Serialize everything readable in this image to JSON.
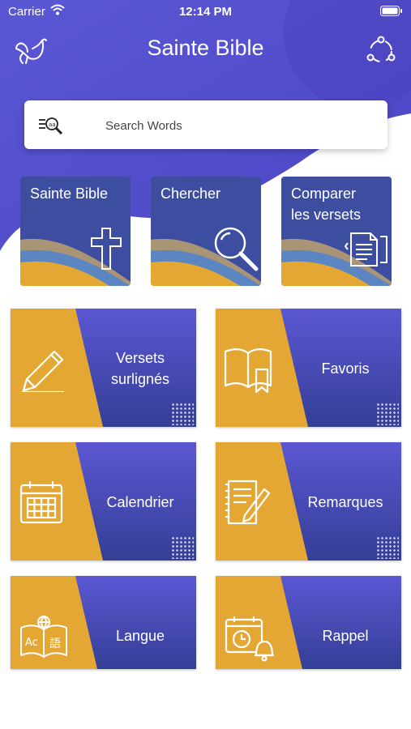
{
  "status_bar": {
    "carrier": "Carrier",
    "time": "12:14 PM"
  },
  "header": {
    "title": "Sainte Bible",
    "left_icon": "dove-icon",
    "right_icon": "share-icon"
  },
  "search": {
    "placeholder": "Search Words",
    "value": ""
  },
  "tiles": [
    {
      "label": "Sainte Bible",
      "icon": "cross-icon"
    },
    {
      "label": "Chercher",
      "icon": "magnifier-icon"
    },
    {
      "label_line1": "Comparer",
      "label_line2": "les versets",
      "icon": "compare-document-icon"
    }
  ],
  "cards": [
    {
      "label_line1": "Versets",
      "label_line2": "surlignés",
      "icon": "pencil-icon"
    },
    {
      "label": "Favoris",
      "icon": "bookmark-book-icon"
    },
    {
      "label": "Calendrier",
      "icon": "calendar-icon"
    },
    {
      "label": "Remarques",
      "icon": "notes-icon"
    },
    {
      "label": "Langue",
      "icon": "language-book-icon"
    },
    {
      "label": "Rappel",
      "icon": "reminder-icon"
    }
  ],
  "colors": {
    "purple": "#5a57d2",
    "navy": "#3d4ea1",
    "gold": "#e5a733"
  }
}
